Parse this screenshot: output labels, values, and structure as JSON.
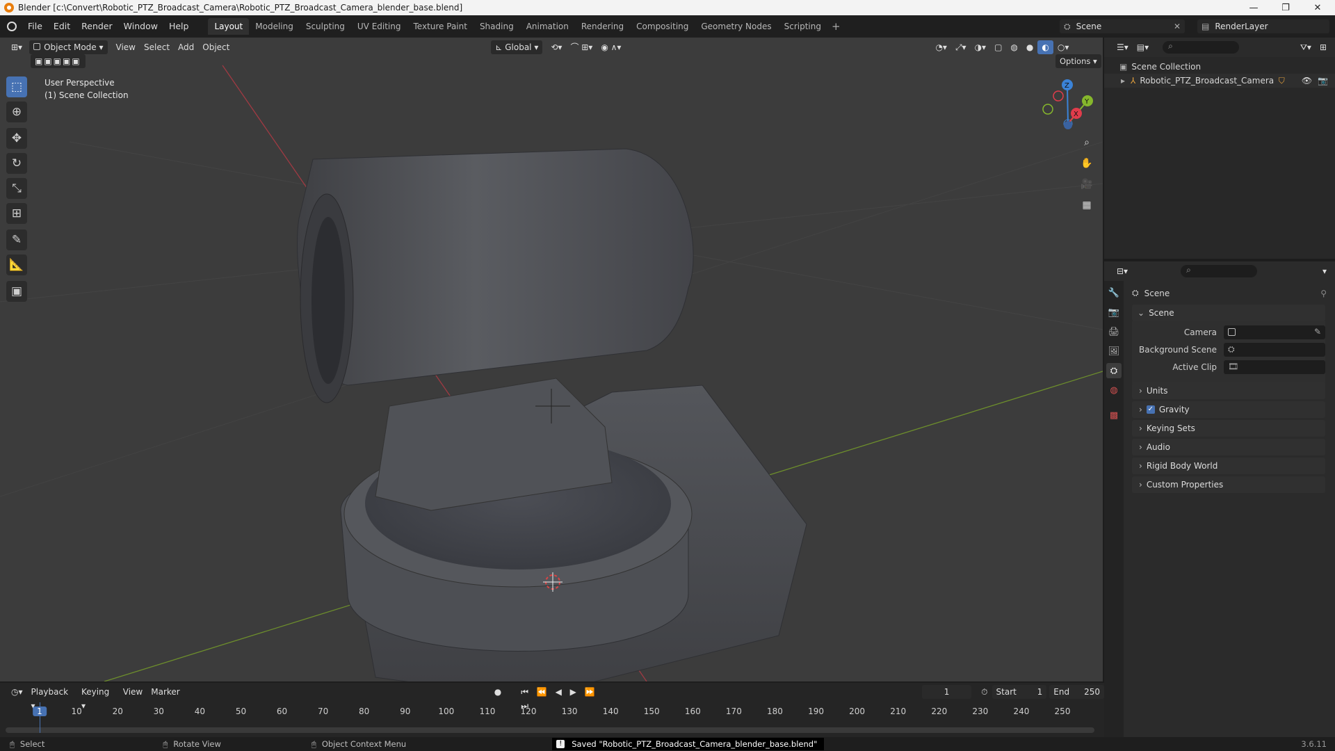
{
  "titlebar": {
    "title": "Blender [c:\\Convert\\Robotic_PTZ_Broadcast_Camera\\Robotic_PTZ_Broadcast_Camera_blender_base.blend]",
    "minimize": "—",
    "maximize": "❐",
    "close": "✕"
  },
  "menu": [
    "File",
    "Edit",
    "Render",
    "Window",
    "Help"
  ],
  "workspaces": [
    "Layout",
    "Modeling",
    "Sculpting",
    "UV Editing",
    "Texture Paint",
    "Shading",
    "Animation",
    "Rendering",
    "Compositing",
    "Geometry Nodes",
    "Scripting"
  ],
  "active_workspace": "Layout",
  "scene": {
    "name": "Scene",
    "render_layer": "RenderLayer"
  },
  "viewport": {
    "mode": "Object Mode",
    "menus": [
      "View",
      "Select",
      "Add",
      "Object"
    ],
    "orientation": "Global",
    "options": "Options",
    "perspective": "User Perspective",
    "collection": "(1) Scene Collection",
    "axes": {
      "x": "X",
      "y": "Y",
      "z": "Z"
    }
  },
  "outliner": {
    "root": "Scene Collection",
    "items": [
      {
        "label": "Robotic_PTZ_Broadcast_Camera"
      }
    ]
  },
  "properties": {
    "header": "Scene",
    "section": "Scene",
    "fields": [
      {
        "label": "Camera"
      },
      {
        "label": "Background Scene"
      },
      {
        "label": "Active Clip"
      }
    ],
    "panels": [
      "Units",
      "Gravity",
      "Keying Sets",
      "Audio",
      "Rigid Body World",
      "Custom Properties"
    ],
    "gravity_checked": true
  },
  "timeline": {
    "menus": [
      "Playback",
      "Keying",
      "View",
      "Marker"
    ],
    "current_frame": "1",
    "start_label": "Start",
    "start": "1",
    "end_label": "End",
    "end": "250",
    "ticks": [
      "1",
      "10",
      "20",
      "30",
      "40",
      "50",
      "60",
      "70",
      "80",
      "90",
      "100",
      "110",
      "120",
      "130",
      "140",
      "150",
      "160",
      "170",
      "180",
      "190",
      "200",
      "210",
      "220",
      "230",
      "240",
      "250"
    ]
  },
  "status": {
    "select": "Select",
    "rotate": "Rotate View",
    "context": "Object Context Menu",
    "message": "Saved \"Robotic_PTZ_Broadcast_Camera_blender_base.blend\"",
    "version": "3.6.11"
  },
  "colors": {
    "accent": "#4772b3",
    "x_axis": "#e03c4b",
    "y_axis": "#86b72c",
    "z_axis": "#3b83d8"
  }
}
